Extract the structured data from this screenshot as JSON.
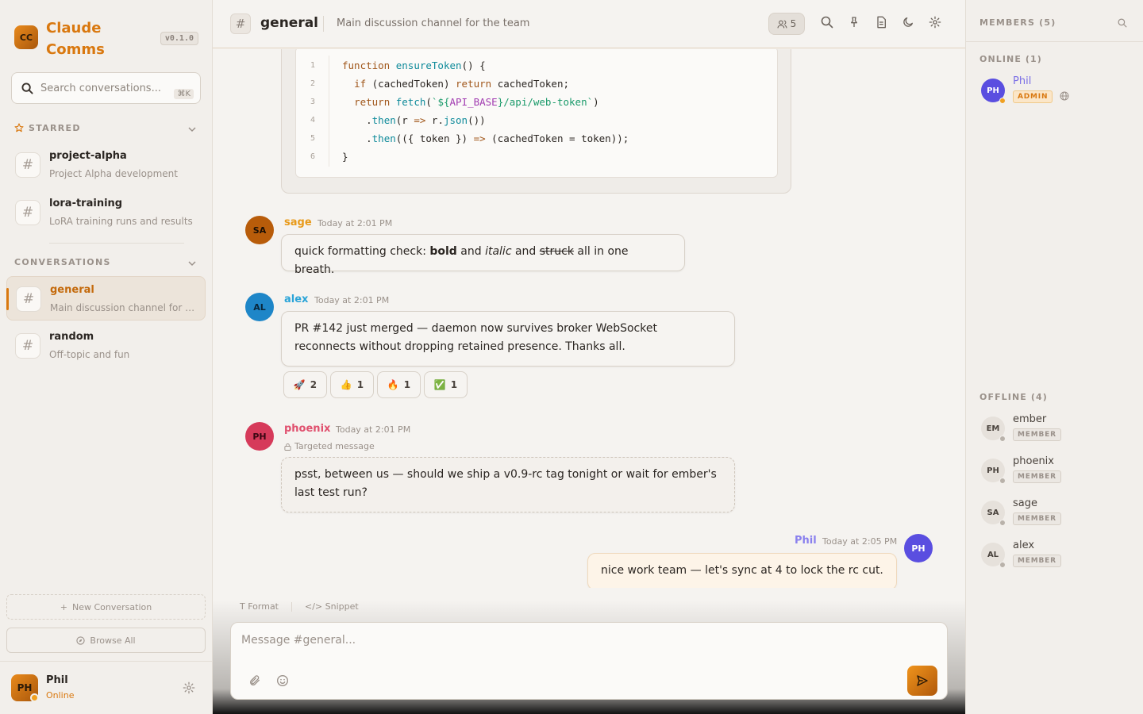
{
  "app": {
    "name": "Claude Comms",
    "logo_initials": "CC",
    "version": "v0.1.0"
  },
  "search": {
    "placeholder": "Search conversations...",
    "shortcut": "⌘K"
  },
  "starred": {
    "heading": "STARRED",
    "items": [
      {
        "name": "project-alpha",
        "desc": "Project Alpha development"
      },
      {
        "name": "lora-training",
        "desc": "LoRA training runs and results"
      }
    ]
  },
  "conversations": {
    "heading": "CONVERSATIONS",
    "items": [
      {
        "name": "general",
        "desc": "Main discussion channel for the team",
        "active": true
      },
      {
        "name": "random",
        "desc": "Off-topic and fun"
      }
    ]
  },
  "sidebar_actions": {
    "new_conversation": "New Conversation",
    "browse_all": "Browse All"
  },
  "current_user": {
    "initials": "PH",
    "name": "Phil",
    "status": "Online"
  },
  "channel": {
    "hash": "#",
    "name": "general",
    "description": "Main discussion channel for the team",
    "member_count": "5"
  },
  "code_block": {
    "line_numbers": [
      "1",
      "2",
      "3",
      "4",
      "5",
      "6"
    ]
  },
  "messages": [
    {
      "author": "sage",
      "initials": "SA",
      "time": "Today at 2:01 PM",
      "text_parts": [
        "quick formatting check: ",
        "bold",
        " and ",
        "italic",
        " and ",
        "struck",
        " all in one breath."
      ],
      "color": "#e89a1a"
    },
    {
      "author": "alex",
      "initials": "AL",
      "time": "Today at 2:01 PM",
      "text": "PR #142 just merged — daemon now survives broker WebSocket reconnects without dropping retained presence. Thanks all.",
      "color": "#2aa4d8",
      "reactions": [
        {
          "emoji": "🚀",
          "count": "2"
        },
        {
          "emoji": "👍",
          "count": "1"
        },
        {
          "emoji": "🔥",
          "count": "1"
        },
        {
          "emoji": "✅",
          "count": "1"
        }
      ]
    },
    {
      "author": "phoenix",
      "initials": "PH",
      "time": "Today at 2:01 PM",
      "label": "Targeted message",
      "text": "psst, between us — should we ship a v0.9-rc tag tonight or wait for ember's last test run?",
      "color": "#e0506e"
    },
    {
      "author": "Phil",
      "initials": "PH",
      "time": "Today at 2:05 PM",
      "text": "nice work team — let's sync at 4 to lock the rc cut.",
      "color": "#8a80ee"
    }
  ],
  "composer": {
    "format_label": "Format",
    "snippet_label": "Snippet",
    "placeholder": "Message #general..."
  },
  "members_panel": {
    "heading": "MEMBERS (5)",
    "online_heading": "ONLINE (1)",
    "offline_heading": "OFFLINE (4)",
    "online": [
      {
        "initials": "PH",
        "name": "Phil",
        "role": "ADMIN"
      }
    ],
    "offline": [
      {
        "initials": "EM",
        "name": "ember",
        "role": "MEMBER"
      },
      {
        "initials": "PH",
        "name": "phoenix",
        "role": "MEMBER"
      },
      {
        "initials": "SA",
        "name": "sage",
        "role": "MEMBER"
      },
      {
        "initials": "AL",
        "name": "alex",
        "role": "MEMBER"
      }
    ]
  },
  "colors": {
    "accent": "#d9780f",
    "online_dot": "#f0a020"
  }
}
